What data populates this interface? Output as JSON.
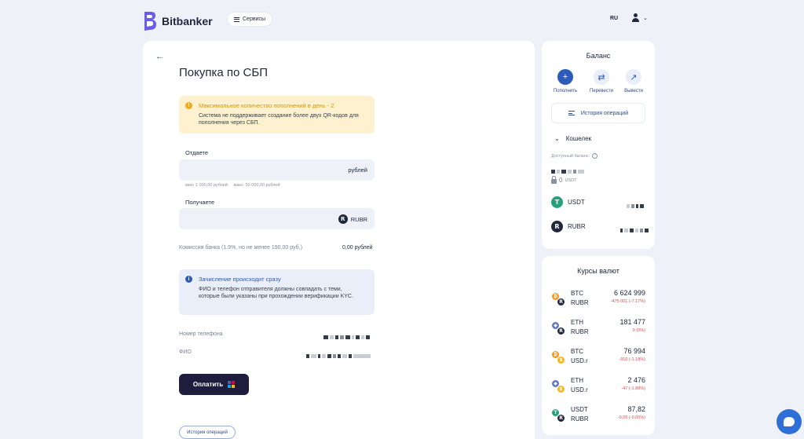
{
  "header": {
    "brand": "Bitbanker",
    "services_label": "Сервисы",
    "lang": "RU"
  },
  "purchase": {
    "title": "Покупка по СБП",
    "warning": {
      "title": "Максимальное количество пополнений в день - 2",
      "text": "Система не поддерживает создание более двух QR-кодов для пополнения через СБП."
    },
    "give": {
      "label": "Отдаете",
      "unit": "рублей",
      "min": "мин: 1 000,00 рублей",
      "max": "макс: 50 000,00 рублей"
    },
    "receive": {
      "label": "Получаете",
      "unit": "RUBR",
      "coin_glyph": "R"
    },
    "commission": {
      "label": "Комиссия банка (1.9%, но не менее 190,00 руб.)",
      "value": "0,00 рублей"
    },
    "info": {
      "title": "Зачисление происходит сразу",
      "text": "ФИО и телефон отправителя должны совпадать с теми, которые были указаны при прохождении верификации KYC."
    },
    "phone_label": "Номер телефона",
    "name_label": "ФИО",
    "pay_label": "Оплатить",
    "history_label": "История операций"
  },
  "balance": {
    "title": "Баланс",
    "actions": [
      {
        "label": "Пополнить",
        "icon": "plus-icon",
        "glyph": "+"
      },
      {
        "label": "Перевести",
        "icon": "transfer-icon",
        "glyph": "⇄"
      },
      {
        "label": "Вывести",
        "icon": "withdraw-icon",
        "glyph": "↗"
      }
    ],
    "history_label": "История операций",
    "wallet_label": "Кошелек",
    "available_label": "Доступный баланс:",
    "locked_value": "0",
    "locked_unit": "USDT",
    "assets": [
      {
        "name": "USDT",
        "glyph": "T"
      },
      {
        "name": "RUBR",
        "glyph": "R"
      }
    ]
  },
  "rates": {
    "title": "Курсы валют",
    "items": [
      {
        "base": "BTC",
        "quote": "RUBR",
        "value": "6 624 999",
        "change": "-475 001 (-7.17%)",
        "g1": "₿",
        "g2": "R"
      },
      {
        "base": "ETH",
        "quote": "RUBR",
        "value": "181 477",
        "change": "0 (0%)",
        "g1": "◆",
        "g2": "R"
      },
      {
        "base": "BTC",
        "quote": "USD.r",
        "value": "76 994",
        "change": "-910 (-1.18%)",
        "g1": "₿",
        "g2": "$"
      },
      {
        "base": "ETH",
        "quote": "USD.r",
        "value": "2 476",
        "change": "-47 (-1.88%)",
        "g1": "◆",
        "g2": "$"
      },
      {
        "base": "USDT",
        "quote": "RUBR",
        "value": "87,82",
        "change": "-0,05 (-0.05%)",
        "g1": "T",
        "g2": "R"
      }
    ]
  },
  "colors": {
    "accent": "#2d5bb8",
    "warning": "#d9960b",
    "negative": "#e5484d",
    "dark_button": "#1f1d3d"
  }
}
